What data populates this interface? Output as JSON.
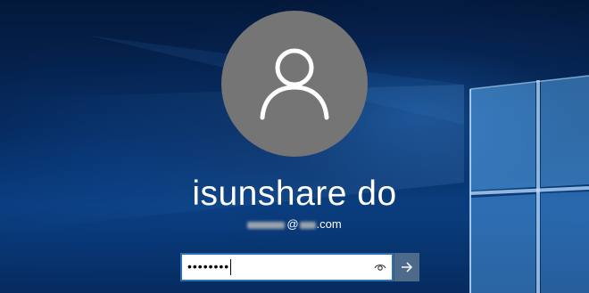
{
  "user": {
    "display_name": "isunshare do",
    "email_visible_part": "@",
    "email_domain": ".com"
  },
  "password_field": {
    "masked_value": "••••••••"
  },
  "icons": {
    "avatar": "user-silhouette-icon",
    "reveal": "eye-icon",
    "submit": "arrow-right-icon"
  },
  "colors": {
    "avatar_background": "#757575",
    "submit_button": "#4e6a8a",
    "field_border": "#2f6fb5",
    "wallpaper_dark": "#04183a",
    "wallpaper_light": "#1e6ec8"
  }
}
